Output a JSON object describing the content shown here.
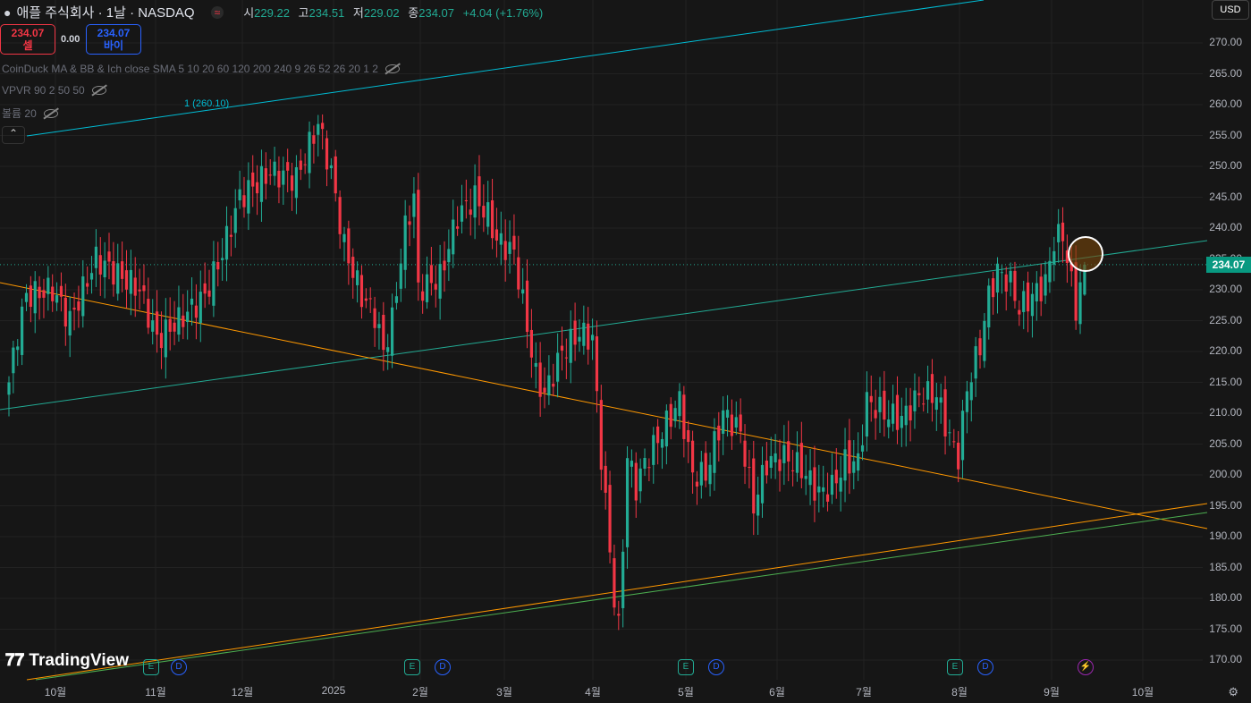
{
  "header": {
    "title": "애플 주식회사 · 1날 · NASDAQ",
    "toggle_icon": "≈",
    "open_label": "시",
    "open": "229.22",
    "high_label": "고",
    "high": "234.51",
    "low_label": "저",
    "low": "229.02",
    "close_label": "종",
    "close": "234.07",
    "change": "+4.04 (+1.76%)"
  },
  "trade": {
    "sell_price": "234.07",
    "sell_label": "셀",
    "spread": "0.00",
    "buy_price": "234.07",
    "buy_label": "바이"
  },
  "indicators": [
    "CoinDuck MA & BB & Ich close SMA 5 10 20 60 120 200 240 9 26 52 26 20 1 2",
    "VPVR 90 2 50 50",
    "볼륨 20"
  ],
  "currency": "USD",
  "trendline_label": "1 (260.10)",
  "current_price_tag": "234.07",
  "logo": "TradingView",
  "events": [
    {
      "t": "E",
      "k": "e"
    },
    {
      "t": "D",
      "k": "d"
    },
    {
      "t": "E",
      "k": "e"
    },
    {
      "t": "D",
      "k": "d"
    },
    {
      "t": "E",
      "k": "e"
    },
    {
      "t": "D",
      "k": "d"
    },
    {
      "t": "E",
      "k": "e"
    },
    {
      "t": "D",
      "k": "d"
    },
    {
      "t": "⚡",
      "k": "l"
    }
  ],
  "colors": {
    "up": "#22ab94",
    "down": "#f23645",
    "bg": "#161616"
  },
  "chart_data": {
    "type": "candlestick",
    "title": "애플 주식회사 · 1날 · NASDAQ",
    "ylim": [
      167,
      273
    ],
    "y_ticks": [
      "270.00",
      "265.00",
      "260.00",
      "255.00",
      "250.00",
      "245.00",
      "240.00",
      "235.00",
      "230.00",
      "225.00",
      "220.00",
      "215.00",
      "210.00",
      "205.00",
      "200.00",
      "195.00",
      "190.00",
      "185.00",
      "180.00",
      "175.00",
      "170.00"
    ],
    "x_ticks": [
      "10월",
      "11월",
      "12월",
      "2025",
      "2월",
      "3월",
      "4월",
      "5월",
      "6월",
      "7월",
      "8월",
      "9월",
      "10월"
    ],
    "approx_closes_by_trading_day": [
      [
        0,
        215
      ],
      [
        2,
        223
      ],
      [
        4,
        229
      ],
      [
        10,
        230
      ],
      [
        14,
        225
      ],
      [
        20,
        235
      ],
      [
        24,
        233
      ],
      [
        30,
        230
      ],
      [
        34,
        222
      ],
      [
        39,
        225
      ],
      [
        45,
        229
      ],
      [
        49,
        236
      ],
      [
        53,
        245
      ],
      [
        60,
        249
      ],
      [
        66,
        248
      ],
      [
        71,
        257
      ],
      [
        74,
        249
      ],
      [
        77,
        237
      ],
      [
        81,
        229
      ],
      [
        84,
        226
      ],
      [
        86,
        220
      ],
      [
        88,
        225
      ],
      [
        91,
        240
      ],
      [
        93,
        245
      ],
      [
        94,
        230
      ],
      [
        99,
        232
      ],
      [
        103,
        242
      ],
      [
        107,
        245
      ],
      [
        110,
        242
      ],
      [
        112,
        238
      ],
      [
        116,
        236
      ],
      [
        118,
        228
      ],
      [
        121,
        216
      ],
      [
        123,
        213
      ],
      [
        127,
        220
      ],
      [
        131,
        223
      ],
      [
        134,
        222
      ],
      [
        136,
        203
      ],
      [
        139,
        180
      ],
      [
        140,
        175
      ],
      [
        142,
        203
      ],
      [
        144,
        198
      ],
      [
        146,
        202
      ],
      [
        150,
        207
      ],
      [
        154,
        212
      ],
      [
        157,
        200
      ],
      [
        160,
        200
      ],
      [
        164,
        210
      ],
      [
        168,
        207
      ],
      [
        171,
        195
      ],
      [
        174,
        202
      ],
      [
        178,
        203
      ],
      [
        182,
        201
      ],
      [
        186,
        197
      ],
      [
        189,
        198
      ],
      [
        192,
        202
      ],
      [
        195,
        202
      ],
      [
        197,
        212
      ],
      [
        201,
        210
      ],
      [
        205,
        209
      ],
      [
        209,
        213
      ],
      [
        213,
        213
      ],
      [
        216,
        206
      ],
      [
        218,
        203
      ],
      [
        220,
        214
      ],
      [
        223,
        221
      ],
      [
        225,
        229
      ],
      [
        227,
        233
      ],
      [
        230,
        231
      ],
      [
        232,
        227
      ],
      [
        235,
        229
      ],
      [
        238,
        231
      ],
      [
        240,
        238
      ],
      [
        242,
        239
      ],
      [
        244,
        231
      ],
      [
        245,
        227
      ],
      [
        247,
        234.07
      ]
    ],
    "last": {
      "open": 229.22,
      "high": 234.51,
      "low": 229.02,
      "close": 234.07
    }
  }
}
